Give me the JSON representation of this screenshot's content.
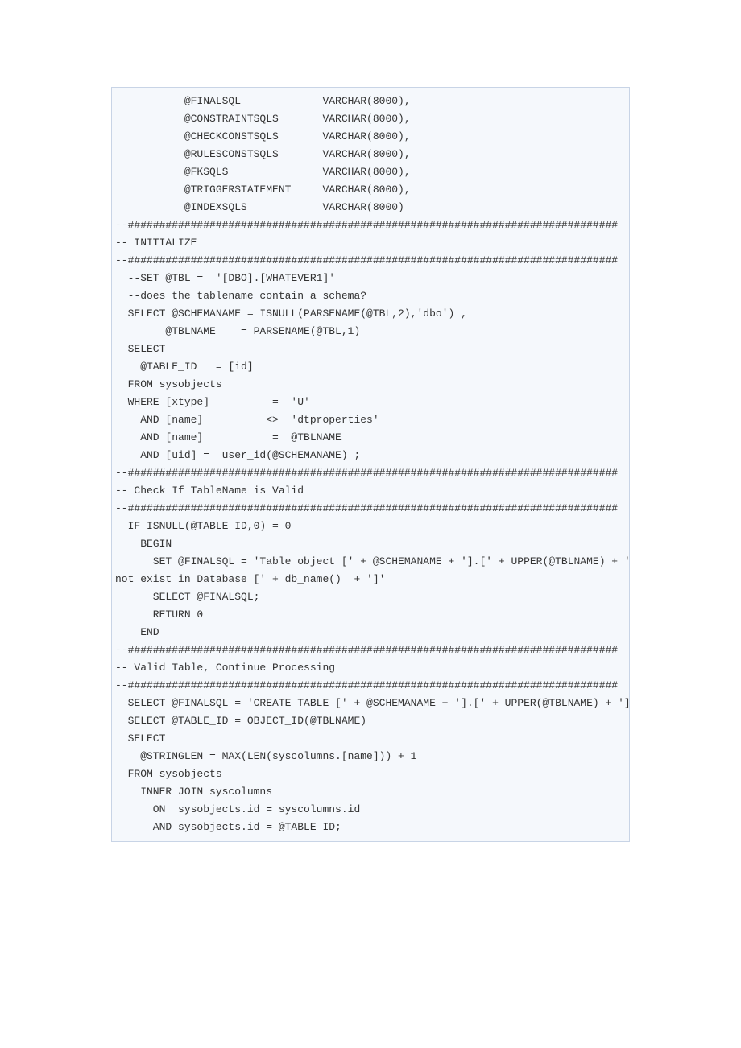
{
  "code": {
    "lines": [
      "           @FINALSQL             VARCHAR(8000),",
      "           @CONSTRAINTSQLS       VARCHAR(8000),",
      "           @CHECKCONSTSQLS       VARCHAR(8000),",
      "           @RULESCONSTSQLS       VARCHAR(8000),",
      "           @FKSQLS               VARCHAR(8000),",
      "           @TRIGGERSTATEMENT     VARCHAR(8000),",
      "           @INDEXSQLS            VARCHAR(8000)",
      "--##############################################################################",
      "-- INITIALIZE",
      "--##############################################################################",
      "  --SET @TBL =  '[DBO].[WHATEVER1]'",
      "  --does the tablename contain a schema?",
      "",
      "  SELECT @SCHEMANAME = ISNULL(PARSENAME(@TBL,2),'dbo') ,",
      "        @TBLNAME    = PARSENAME(@TBL,1)",
      "  SELECT",
      "    @TABLE_ID   = [id]",
      "  FROM sysobjects",
      "  WHERE [xtype]          =  'U'",
      "    AND [name]          <>  'dtproperties'",
      "    AND [name]           =  @TBLNAME",
      "    AND [uid] =  user_id(@SCHEMANAME) ;",
      "",
      "--##############################################################################",
      "-- Check If TableName is Valid",
      "--##############################################################################",
      "  IF ISNULL(@TABLE_ID,0) = 0",
      "    BEGIN",
      "      SET @FINALSQL = 'Table object [' + @SCHEMANAME + '].[' + UPPER(@TBLNAME) + '] does",
      "not exist in Database [' + db_name()  + ']'",
      "      SELECT @FINALSQL;",
      "      RETURN 0",
      "    END",
      "--##############################################################################",
      "-- Valid Table, Continue Processing",
      "--##############################################################################",
      "  SELECT @FINALSQL = 'CREATE TABLE [' + @SCHEMANAME + '].[' + UPPER(@TBLNAME) + '] ( '",
      "  SELECT @TABLE_ID = OBJECT_ID(@TBLNAME)",
      "  SELECT",
      "    @STRINGLEN = MAX(LEN(syscolumns.[name])) + 1",
      "  FROM sysobjects",
      "    INNER JOIN syscolumns",
      "      ON  sysobjects.id = syscolumns.id",
      "      AND sysobjects.id = @TABLE_ID;",
      ""
    ]
  }
}
